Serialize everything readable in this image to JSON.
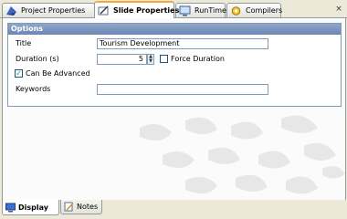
{
  "tabs": [
    {
      "label": "Project Properties",
      "icon": "project-properties-icon"
    },
    {
      "label": "Slide Properties",
      "icon": "slide-properties-icon"
    },
    {
      "label": "RunTime",
      "icon": "runtime-icon"
    },
    {
      "label": "Compilers",
      "icon": "compilers-icon"
    }
  ],
  "close_glyph": "×",
  "options": {
    "header": "Options",
    "title_label": "Title",
    "title_value": "Tourism Development",
    "duration_label": "Duration (s)",
    "duration_value": "5",
    "force_duration_label": "Force Duration",
    "force_duration_checked": false,
    "can_be_advanced_label": "Can Be Advanced",
    "can_be_advanced_checked": true,
    "check_glyph": "✓",
    "keywords_label": "Keywords",
    "keywords_value": ""
  },
  "bottom_tabs": [
    {
      "label": "Display",
      "icon": "display-icon"
    },
    {
      "label": "Notes",
      "icon": "notes-icon"
    }
  ],
  "colors": {
    "accent_tab": "#f8a838",
    "group_header": "#6a86b4",
    "checkmark": "#21a121"
  }
}
